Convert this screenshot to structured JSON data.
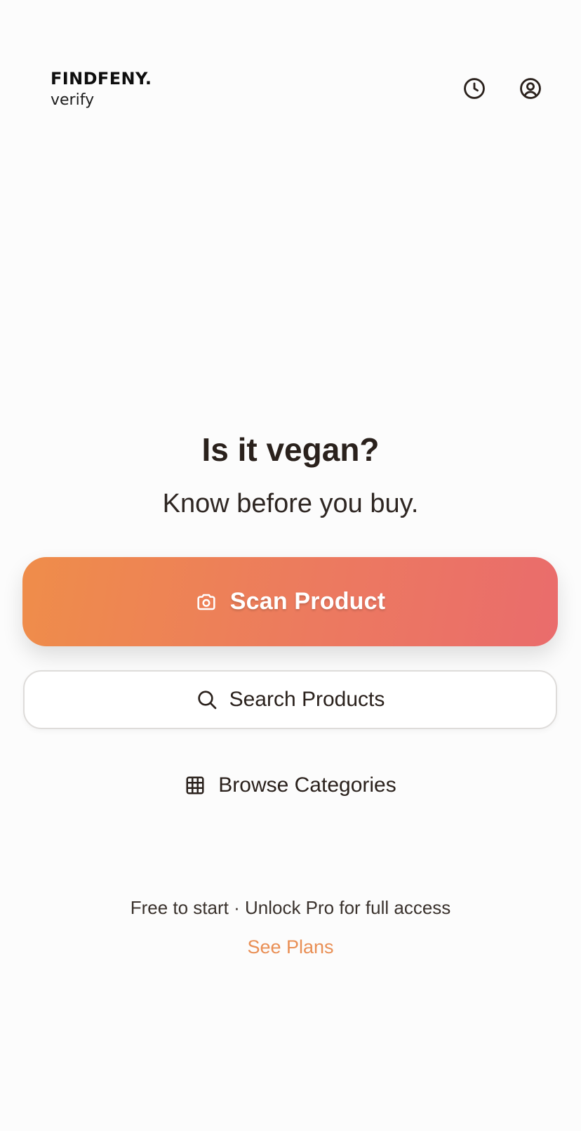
{
  "header": {
    "brand_title": "FINDFENY.",
    "brand_subtitle": "verify",
    "history_icon": "clock-icon",
    "profile_icon": "user-circle-icon"
  },
  "hero": {
    "title": "Is it vegan?",
    "subtitle": "Know before you buy."
  },
  "actions": {
    "scan_label": "Scan Product",
    "scan_icon": "camera-icon",
    "search_label": "Search Products",
    "search_icon": "search-icon",
    "browse_label": "Browse Categories",
    "browse_icon": "grid-icon"
  },
  "footer": {
    "text": "Free to start · Unlock Pro for full access",
    "plans_link": "See Plans"
  },
  "colors": {
    "background": "#fcfcfc",
    "accent_start": "#ef8d4a",
    "accent_end": "#ea6c6c",
    "link": "#e98f55",
    "text": "#2a211c"
  }
}
